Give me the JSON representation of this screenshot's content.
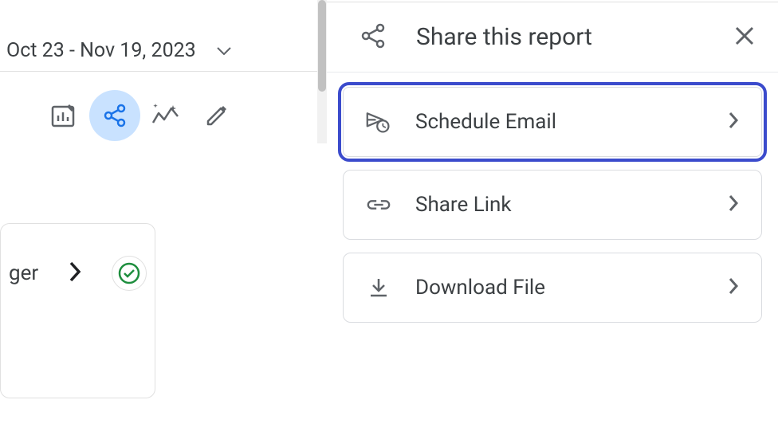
{
  "header": {
    "date_range": "Oct 23 - Nov 19, 2023"
  },
  "card": {
    "partial_text": "ger"
  },
  "panel": {
    "title": "Share this report",
    "options": [
      {
        "label": "Schedule Email"
      },
      {
        "label": "Share Link"
      },
      {
        "label": "Download File"
      }
    ]
  }
}
